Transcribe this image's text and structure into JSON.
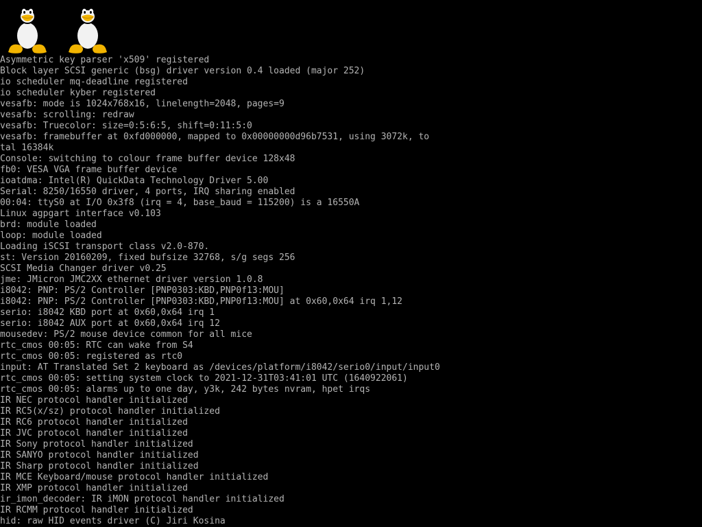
{
  "screen": {
    "background": "#000000",
    "text_color": "#b4b4b4"
  },
  "boot_logo": {
    "icon": "tux-penguin-icon",
    "count": 2
  },
  "console": {
    "lines": [
      "Asymmetric key parser 'x509' registered",
      "Block layer SCSI generic (bsg) driver version 0.4 loaded (major 252)",
      "io scheduler mq-deadline registered",
      "io scheduler kyber registered",
      "vesafb: mode is 1024x768x16, linelength=2048, pages=9",
      "vesafb: scrolling: redraw",
      "vesafb: Truecolor: size=0:5:6:5, shift=0:11:5:0",
      "vesafb: framebuffer at 0xfd000000, mapped to 0x00000000d96b7531, using 3072k, to",
      "tal 16384k",
      "Console: switching to colour frame buffer device 128x48",
      "fb0: VESA VGA frame buffer device",
      "ioatdma: Intel(R) QuickData Technology Driver 5.00",
      "Serial: 8250/16550 driver, 4 ports, IRQ sharing enabled",
      "00:04: ttyS0 at I/O 0x3f8 (irq = 4, base_baud = 115200) is a 16550A",
      "Linux agpgart interface v0.103",
      "brd: module loaded",
      "loop: module loaded",
      "Loading iSCSI transport class v2.0-870.",
      "st: Version 20160209, fixed bufsize 32768, s/g segs 256",
      "SCSI Media Changer driver v0.25",
      "jme: JMicron JMC2XX ethernet driver version 1.0.8",
      "i8042: PNP: PS/2 Controller [PNP0303:KBD,PNP0f13:MOU]",
      "i8042: PNP: PS/2 Controller [PNP0303:KBD,PNP0f13:MOU] at 0x60,0x64 irq 1,12",
      "serio: i8042 KBD port at 0x60,0x64 irq 1",
      "serio: i8042 AUX port at 0x60,0x64 irq 12",
      "mousedev: PS/2 mouse device common for all mice",
      "rtc_cmos 00:05: RTC can wake from S4",
      "rtc_cmos 00:05: registered as rtc0",
      "input: AT Translated Set 2 keyboard as /devices/platform/i8042/serio0/input/input0",
      "rtc_cmos 00:05: setting system clock to 2021-12-31T03:41:01 UTC (1640922061)",
      "rtc_cmos 00:05: alarms up to one day, y3k, 242 bytes nvram, hpet irqs",
      "IR NEC protocol handler initialized",
      "IR RC5(x/sz) protocol handler initialized",
      "IR RC6 protocol handler initialized",
      "IR JVC protocol handler initialized",
      "IR Sony protocol handler initialized",
      "IR SANYO protocol handler initialized",
      "IR Sharp protocol handler initialized",
      "IR MCE Keyboard/mouse protocol handler initialized",
      "IR XMP protocol handler initialized",
      "ir_imon_decoder: IR iMON protocol handler initialized",
      "IR RCMM protocol handler initialized",
      "hid: raw HID events driver (C) Jiri Kosina"
    ]
  }
}
